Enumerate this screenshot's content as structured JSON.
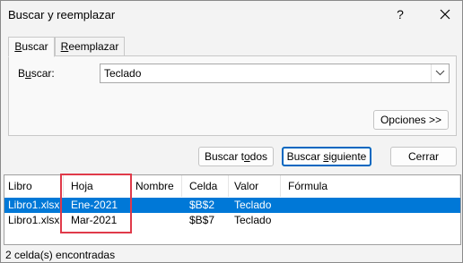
{
  "window": {
    "title": "Buscar y reemplazar",
    "help_glyph": "?",
    "close_icon": "close-icon"
  },
  "tabs": [
    {
      "pre": "",
      "key": "B",
      "post": "uscar",
      "active": true
    },
    {
      "pre": "",
      "key": "R",
      "post": "eemplazar",
      "active": false
    }
  ],
  "find": {
    "label_pre": "B",
    "label_key": "u",
    "label_post": "scar:",
    "value": "Teclado"
  },
  "buttons": {
    "options": "Opciones >>",
    "find_all_pre": "Buscar t",
    "find_all_key": "o",
    "find_all_post": "dos",
    "find_next_pre": "Buscar ",
    "find_next_key": "s",
    "find_next_post": "iguiente",
    "close": "Cerrar"
  },
  "results": {
    "columns": [
      "Libro",
      "Hoja",
      "Nombre",
      "Celda",
      "Valor",
      "Fórmula"
    ],
    "rows": [
      {
        "libro": "Libro1.xlsx",
        "hoja": "Ene-2021",
        "nombre": "",
        "celda": "$B$2",
        "valor": "Teclado",
        "formula": "",
        "selected": true
      },
      {
        "libro": "Libro1.xlsx",
        "hoja": "Mar-2021",
        "nombre": "",
        "celda": "$B$7",
        "valor": "Teclado",
        "formula": "",
        "selected": false
      }
    ]
  },
  "status": "2 celda(s) encontradas",
  "colors": {
    "selection": "#0078d7",
    "highlight": "#e03a4a",
    "default_button_border": "#0067c0"
  }
}
